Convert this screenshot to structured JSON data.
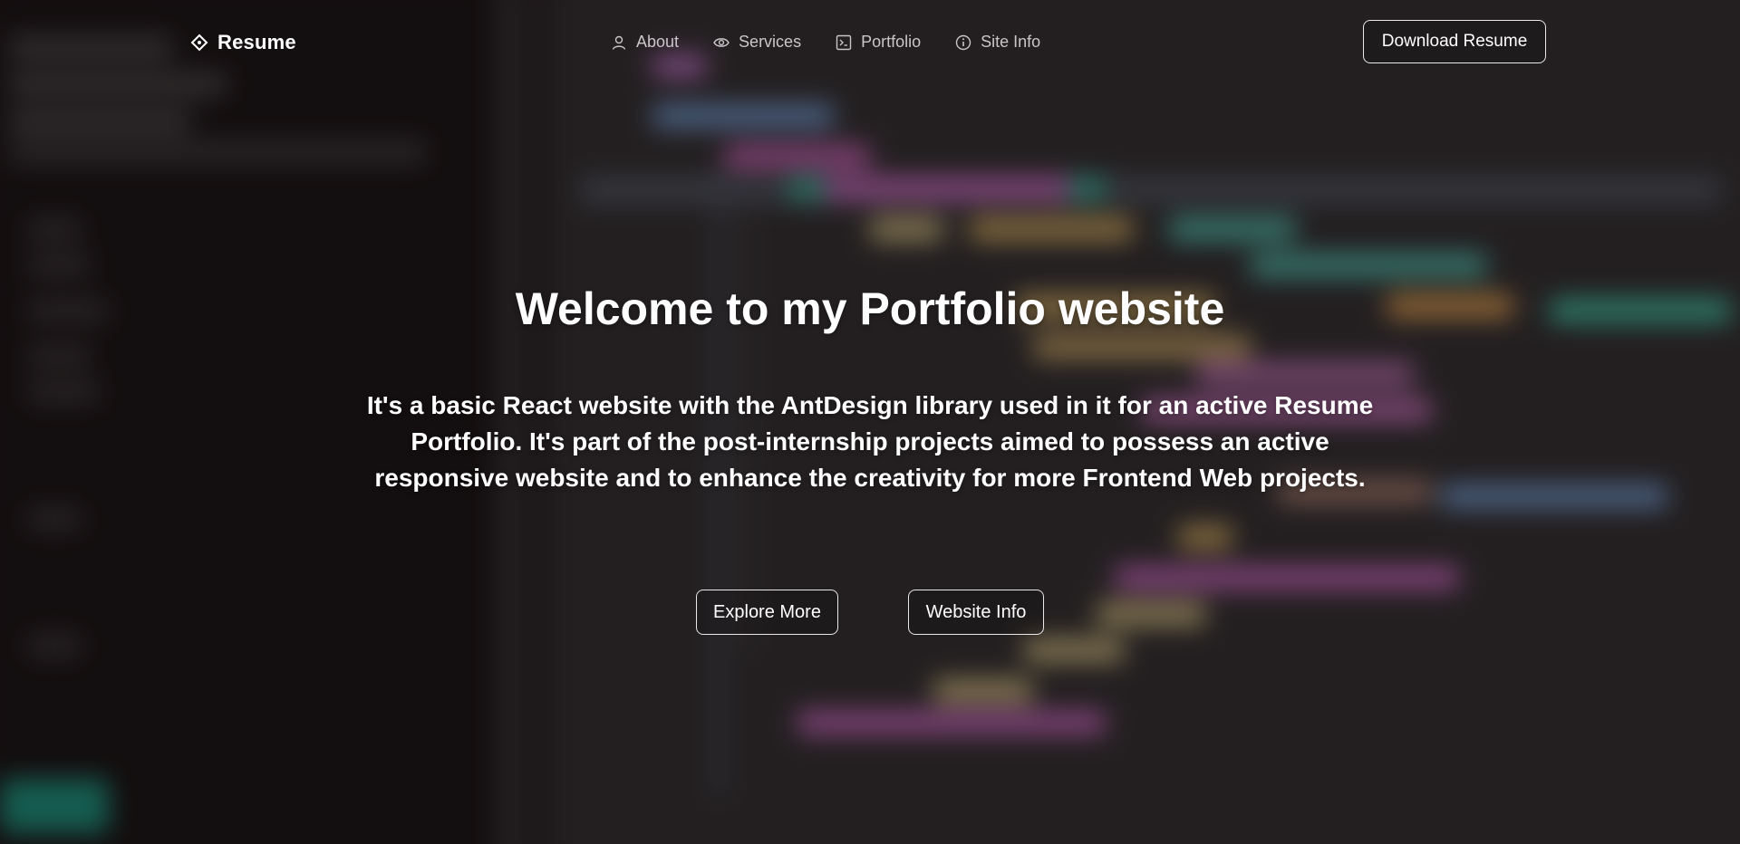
{
  "nav": {
    "brand": "Resume",
    "menu": [
      {
        "label": "About",
        "icon": "user-icon"
      },
      {
        "label": "Services",
        "icon": "eye-icon"
      },
      {
        "label": "Portfolio",
        "icon": "code-icon"
      },
      {
        "label": "Site Info",
        "icon": "info-icon"
      }
    ],
    "download_label": "Download Resume"
  },
  "hero": {
    "title": "Welcome to my Portfolio website",
    "description": "It's a basic React website with the AntDesign library used in it for an active Resume Portfolio. It's part of the post-internship projects aimed to possess an active responsive website and to enhance the creativity for more Frontend Web projects.",
    "explore_label": "Explore More",
    "info_label": "Website Info"
  },
  "colors": {
    "text": "#ffffff",
    "menu_text": "#c9c6c7",
    "button_border": "#e9e9e9",
    "background": "#2a2426"
  }
}
